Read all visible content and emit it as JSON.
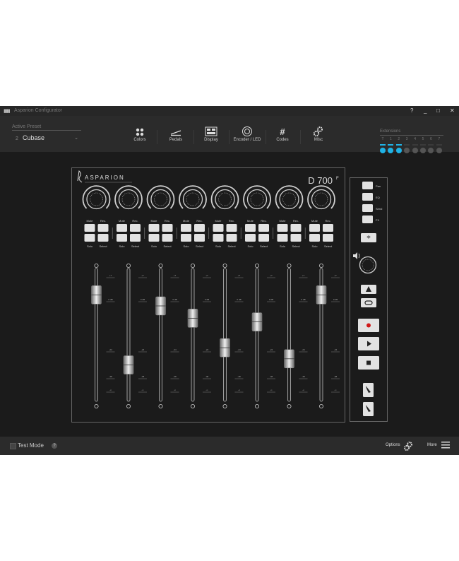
{
  "window": {
    "app_icon": "grid-icon",
    "title": "Asparion Configurator",
    "controls": [
      "?",
      "_",
      "□",
      "✕"
    ]
  },
  "preset": {
    "label": "Active Preset",
    "number": "2",
    "name": "Cubase"
  },
  "nav": [
    {
      "label": "Colors",
      "icon": "colors-icon"
    },
    {
      "label": "Pedals",
      "icon": "pedals-icon"
    },
    {
      "label": "Display",
      "icon": "display-icon"
    },
    {
      "label": "Encoder / LED",
      "icon": "encoder-icon"
    },
    {
      "label": "Codes",
      "icon": "hash-icon"
    },
    {
      "label": "Misc",
      "icon": "gears-icon"
    }
  ],
  "extensions": {
    "label": "Extensions",
    "numbers": [
      "T",
      "1",
      "2",
      "3",
      "4",
      "5",
      "6",
      "7"
    ],
    "active_count": 3,
    "active_color": "#1fb3e6",
    "inactive_color": "#555555"
  },
  "device": {
    "brand": "ASPARION",
    "model": "D 700",
    "model_suffix": "F",
    "button_labels": {
      "mute": "Mute",
      "rec": "Rec.",
      "solo": "Solo",
      "select": "Select"
    },
    "scale_labels": [
      "+7",
      "0 dB",
      "-24",
      "-48",
      "-∞"
    ],
    "fader_levels": [
      0.82,
      0.25,
      0.73,
      0.63,
      0.39,
      0.6,
      0.3,
      0.82
    ]
  },
  "side_panel": {
    "labels": [
      "Pan",
      "EQ",
      "Send",
      "FX"
    ]
  },
  "status": {
    "test_mode": "Test Mode",
    "help": "?",
    "options": "Options",
    "more": "More"
  },
  "colors": {
    "accent": "#1fb3e6",
    "record": "#d01818",
    "background": "#1b1b1b"
  }
}
